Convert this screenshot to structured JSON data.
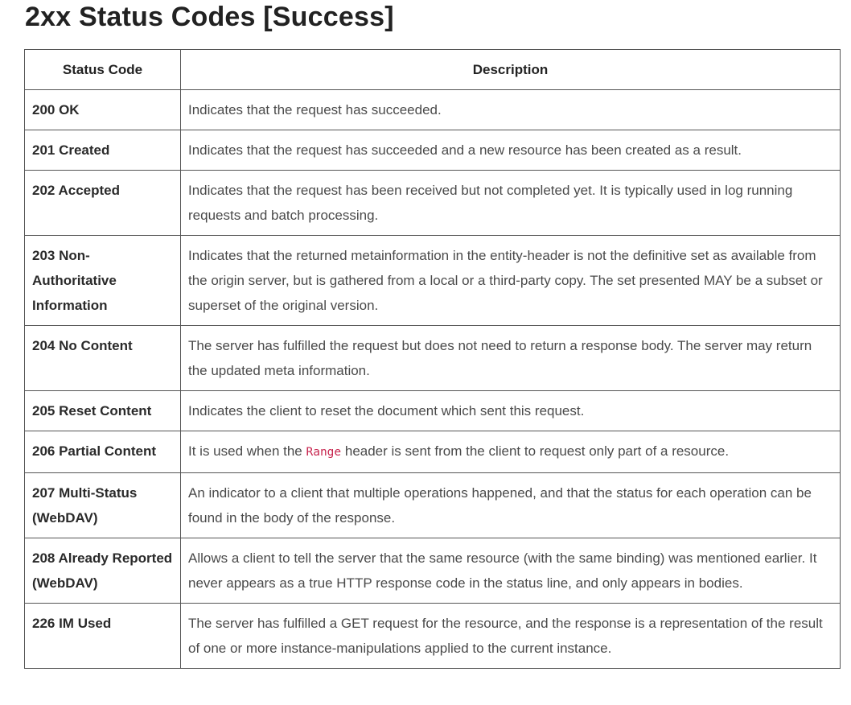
{
  "heading": "2xx Status Codes [Success]",
  "table": {
    "headers": [
      "Status Code",
      "Description"
    ],
    "rows": [
      {
        "code": "200 OK",
        "description": "Indicates that the request has succeeded."
      },
      {
        "code": "201 Created",
        "description": "Indicates that the request has succeeded and a new resource has been created as a result."
      },
      {
        "code": "202 Accepted",
        "description": "Indicates that the request has been received but not completed yet. It is typically used in log running requests and batch processing."
      },
      {
        "code": "203 Non-Authoritative Information",
        "description": "Indicates that the returned metainformation in the entity-header is not the definitive set as available from the origin server, but is gathered from a local or a third-party copy. The set presented MAY be a subset or superset of the original version."
      },
      {
        "code": "204 No Content",
        "description": "The server has fulfilled the request but does not need to return a response body. The server may return the updated meta information."
      },
      {
        "code": "205 Reset Content",
        "description": "Indicates the client to reset the document which sent this request."
      },
      {
        "code": "206 Partial Content",
        "description_before": "It is used when the ",
        "description_code": "Range",
        "description_after": " header is sent from the client to request only part of a resource."
      },
      {
        "code": "207 Multi-Status (WebDAV)",
        "description": "An indicator to a client that multiple operations happened, and that the status for each operation can be found in the body of the response."
      },
      {
        "code": "208 Already Reported (WebDAV)",
        "description": "Allows a client to tell the server that the same resource (with the same binding) was mentioned earlier. It never appears as a true HTTP response code in the status line, and only appears in bodies."
      },
      {
        "code": "226 IM Used",
        "description": "The server has fulfilled a GET request for the resource, and the response is a representation of the result of one or more instance-manipulations applied to the current instance."
      }
    ]
  },
  "colors": {
    "border": "#555555",
    "inline_code": "#c7254e"
  }
}
